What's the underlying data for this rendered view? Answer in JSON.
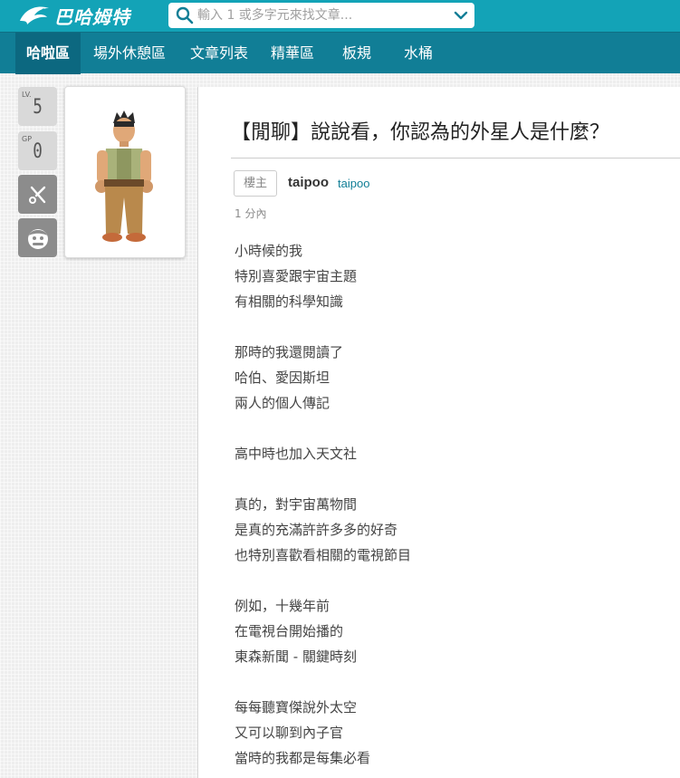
{
  "header": {
    "logo_text": "巴哈姆特",
    "search_placeholder": "輸入 1 或多字元來找文章..."
  },
  "nav": {
    "items": [
      {
        "label": "哈啦區",
        "active": true
      },
      {
        "label": "場外休憩區",
        "active": false
      },
      {
        "label": "文章列表",
        "active": false
      },
      {
        "label": "精華區",
        "active": false
      },
      {
        "label": "板規",
        "active": false
      },
      {
        "label": "水桶",
        "active": false
      }
    ]
  },
  "sidebar": {
    "level_label": "LV.",
    "level_value": "5",
    "gp_label": "GP",
    "gp_value": "0",
    "tools": [
      {
        "icon": "wrench-icon"
      },
      {
        "icon": "mascot-icon"
      }
    ]
  },
  "post": {
    "title": "【閒聊】說說看，你認為的外星人是什麼？",
    "author_tag": "樓主",
    "author_name": "taipoo",
    "author_id": "taipoo",
    "time": "1 分內",
    "lines": [
      "小時候的我",
      "特別喜愛跟宇宙主題",
      "有相關的科學知識",
      "",
      "那時的我還閱讀了",
      "哈伯、愛因斯坦",
      "兩人的個人傳記",
      "",
      "高中時也加入天文社",
      "",
      "真的，對宇宙萬物間",
      "是真的充滿許許多多的好奇",
      "也特別喜歡看相關的電視節目",
      "",
      "例如，十幾年前",
      "在電視台開始播的",
      "東森新聞 - 關鍵時刻",
      "",
      "每每聽寶傑說外太空",
      "又可以聊到內子官",
      "當時的我都是每集必看"
    ]
  },
  "colors": {
    "topbar": "#13a3b7",
    "navbar": "#117e96",
    "nav_active": "#0c6880",
    "link": "#117e96"
  }
}
